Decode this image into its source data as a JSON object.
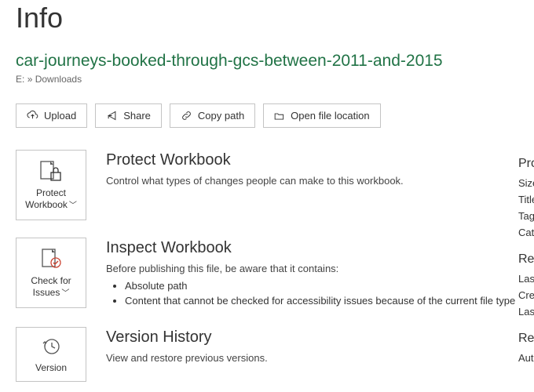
{
  "page": {
    "title": "Info"
  },
  "file": {
    "name": "car-journeys-booked-through-gcs-between-2011-and-2015"
  },
  "breadcrumb": {
    "drive": "E:",
    "sep": "»",
    "folder": "Downloads"
  },
  "toolbar": {
    "upload": "Upload",
    "share": "Share",
    "copy_path": "Copy path",
    "open_location": "Open file location"
  },
  "protect": {
    "card_line1": "Protect",
    "card_line2": "Workbook",
    "title": "Protect Workbook",
    "text": "Control what types of changes people can make to this workbook."
  },
  "inspect": {
    "card_line1": "Check for",
    "card_line2": "Issues",
    "title": "Inspect Workbook",
    "intro": "Before publishing this file, be aware that it contains:",
    "b1": "Absolute path",
    "b2": "Content that cannot be checked for accessibility issues because of the current file type"
  },
  "history": {
    "card_line1": "Version",
    "title": "Version History",
    "text": "View and restore previous versions."
  },
  "right": {
    "h1": "Pro",
    "size": "Size",
    "title_l": "Title",
    "tags": "Tags",
    "cate": "Cate",
    "h2": "Rel",
    "last": "Last",
    "crea": "Crea",
    "last2": "Last",
    "h3": "Rel",
    "auth": "Auth"
  }
}
